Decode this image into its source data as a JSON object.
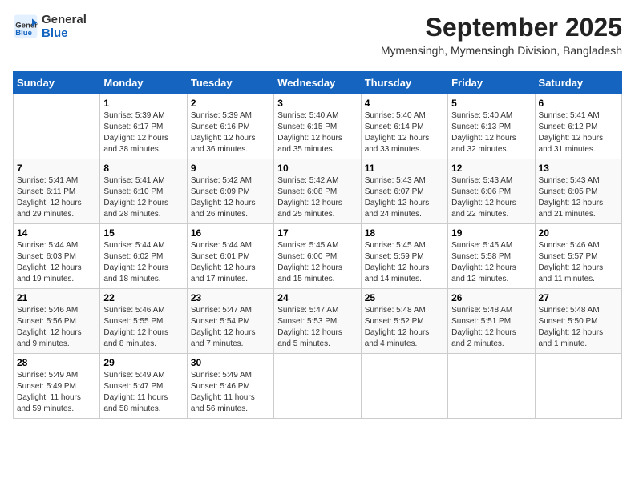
{
  "header": {
    "logo_line1": "General",
    "logo_line2": "Blue",
    "month_title": "September 2025",
    "location": "Mymensingh, Mymensingh Division, Bangladesh"
  },
  "weekdays": [
    "Sunday",
    "Monday",
    "Tuesday",
    "Wednesday",
    "Thursday",
    "Friday",
    "Saturday"
  ],
  "weeks": [
    [
      {
        "day": "",
        "info": ""
      },
      {
        "day": "1",
        "info": "Sunrise: 5:39 AM\nSunset: 6:17 PM\nDaylight: 12 hours\nand 38 minutes."
      },
      {
        "day": "2",
        "info": "Sunrise: 5:39 AM\nSunset: 6:16 PM\nDaylight: 12 hours\nand 36 minutes."
      },
      {
        "day": "3",
        "info": "Sunrise: 5:40 AM\nSunset: 6:15 PM\nDaylight: 12 hours\nand 35 minutes."
      },
      {
        "day": "4",
        "info": "Sunrise: 5:40 AM\nSunset: 6:14 PM\nDaylight: 12 hours\nand 33 minutes."
      },
      {
        "day": "5",
        "info": "Sunrise: 5:40 AM\nSunset: 6:13 PM\nDaylight: 12 hours\nand 32 minutes."
      },
      {
        "day": "6",
        "info": "Sunrise: 5:41 AM\nSunset: 6:12 PM\nDaylight: 12 hours\nand 31 minutes."
      }
    ],
    [
      {
        "day": "7",
        "info": "Sunrise: 5:41 AM\nSunset: 6:11 PM\nDaylight: 12 hours\nand 29 minutes."
      },
      {
        "day": "8",
        "info": "Sunrise: 5:41 AM\nSunset: 6:10 PM\nDaylight: 12 hours\nand 28 minutes."
      },
      {
        "day": "9",
        "info": "Sunrise: 5:42 AM\nSunset: 6:09 PM\nDaylight: 12 hours\nand 26 minutes."
      },
      {
        "day": "10",
        "info": "Sunrise: 5:42 AM\nSunset: 6:08 PM\nDaylight: 12 hours\nand 25 minutes."
      },
      {
        "day": "11",
        "info": "Sunrise: 5:43 AM\nSunset: 6:07 PM\nDaylight: 12 hours\nand 24 minutes."
      },
      {
        "day": "12",
        "info": "Sunrise: 5:43 AM\nSunset: 6:06 PM\nDaylight: 12 hours\nand 22 minutes."
      },
      {
        "day": "13",
        "info": "Sunrise: 5:43 AM\nSunset: 6:05 PM\nDaylight: 12 hours\nand 21 minutes."
      }
    ],
    [
      {
        "day": "14",
        "info": "Sunrise: 5:44 AM\nSunset: 6:03 PM\nDaylight: 12 hours\nand 19 minutes."
      },
      {
        "day": "15",
        "info": "Sunrise: 5:44 AM\nSunset: 6:02 PM\nDaylight: 12 hours\nand 18 minutes."
      },
      {
        "day": "16",
        "info": "Sunrise: 5:44 AM\nSunset: 6:01 PM\nDaylight: 12 hours\nand 17 minutes."
      },
      {
        "day": "17",
        "info": "Sunrise: 5:45 AM\nSunset: 6:00 PM\nDaylight: 12 hours\nand 15 minutes."
      },
      {
        "day": "18",
        "info": "Sunrise: 5:45 AM\nSunset: 5:59 PM\nDaylight: 12 hours\nand 14 minutes."
      },
      {
        "day": "19",
        "info": "Sunrise: 5:45 AM\nSunset: 5:58 PM\nDaylight: 12 hours\nand 12 minutes."
      },
      {
        "day": "20",
        "info": "Sunrise: 5:46 AM\nSunset: 5:57 PM\nDaylight: 12 hours\nand 11 minutes."
      }
    ],
    [
      {
        "day": "21",
        "info": "Sunrise: 5:46 AM\nSunset: 5:56 PM\nDaylight: 12 hours\nand 9 minutes."
      },
      {
        "day": "22",
        "info": "Sunrise: 5:46 AM\nSunset: 5:55 PM\nDaylight: 12 hours\nand 8 minutes."
      },
      {
        "day": "23",
        "info": "Sunrise: 5:47 AM\nSunset: 5:54 PM\nDaylight: 12 hours\nand 7 minutes."
      },
      {
        "day": "24",
        "info": "Sunrise: 5:47 AM\nSunset: 5:53 PM\nDaylight: 12 hours\nand 5 minutes."
      },
      {
        "day": "25",
        "info": "Sunrise: 5:48 AM\nSunset: 5:52 PM\nDaylight: 12 hours\nand 4 minutes."
      },
      {
        "day": "26",
        "info": "Sunrise: 5:48 AM\nSunset: 5:51 PM\nDaylight: 12 hours\nand 2 minutes."
      },
      {
        "day": "27",
        "info": "Sunrise: 5:48 AM\nSunset: 5:50 PM\nDaylight: 12 hours\nand 1 minute."
      }
    ],
    [
      {
        "day": "28",
        "info": "Sunrise: 5:49 AM\nSunset: 5:49 PM\nDaylight: 11 hours\nand 59 minutes."
      },
      {
        "day": "29",
        "info": "Sunrise: 5:49 AM\nSunset: 5:47 PM\nDaylight: 11 hours\nand 58 minutes."
      },
      {
        "day": "30",
        "info": "Sunrise: 5:49 AM\nSunset: 5:46 PM\nDaylight: 11 hours\nand 56 minutes."
      },
      {
        "day": "",
        "info": ""
      },
      {
        "day": "",
        "info": ""
      },
      {
        "day": "",
        "info": ""
      },
      {
        "day": "",
        "info": ""
      }
    ]
  ]
}
